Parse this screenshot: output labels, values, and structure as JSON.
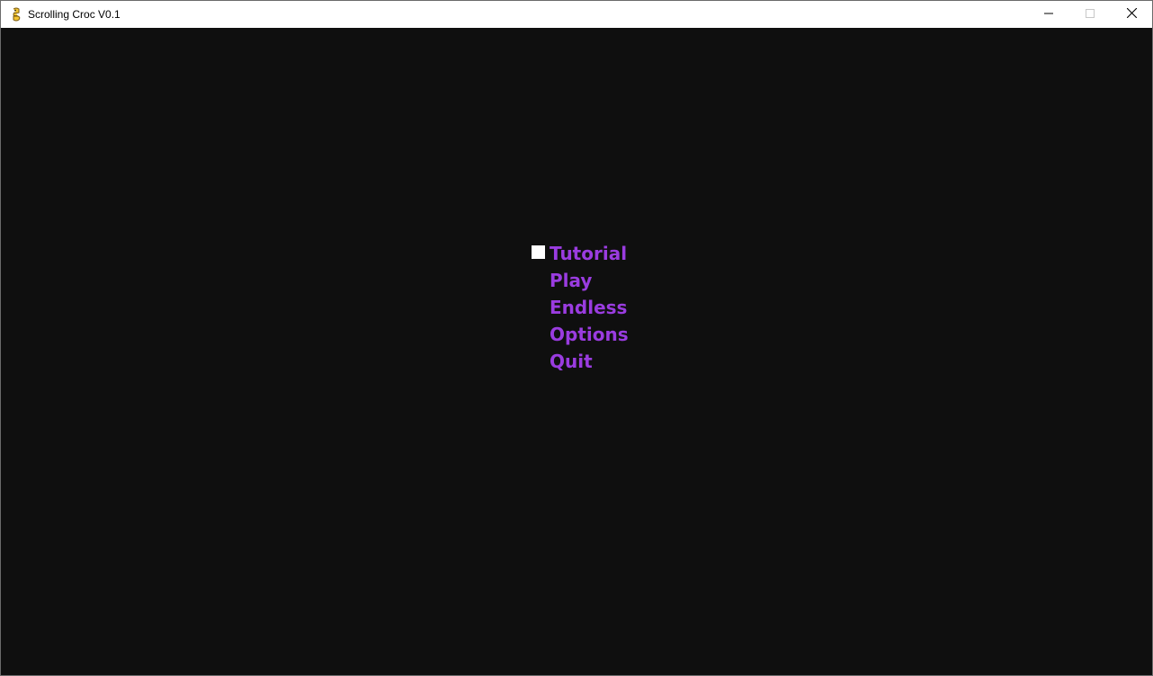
{
  "window": {
    "title": "Scrolling Croc V0.1",
    "icon": "pygame-snake-icon",
    "controls": {
      "minimize": "minimize-icon",
      "maximize": "maximize-icon",
      "close": "close-icon"
    }
  },
  "menu": {
    "selected_index": 0,
    "items": [
      {
        "label": "Tutorial"
      },
      {
        "label": "Play"
      },
      {
        "label": "Endless"
      },
      {
        "label": "Options"
      },
      {
        "label": "Quit"
      }
    ]
  },
  "colors": {
    "background": "#0f0f0f",
    "menu_text": "#9a3ce0",
    "cursor": "#ffffff"
  }
}
